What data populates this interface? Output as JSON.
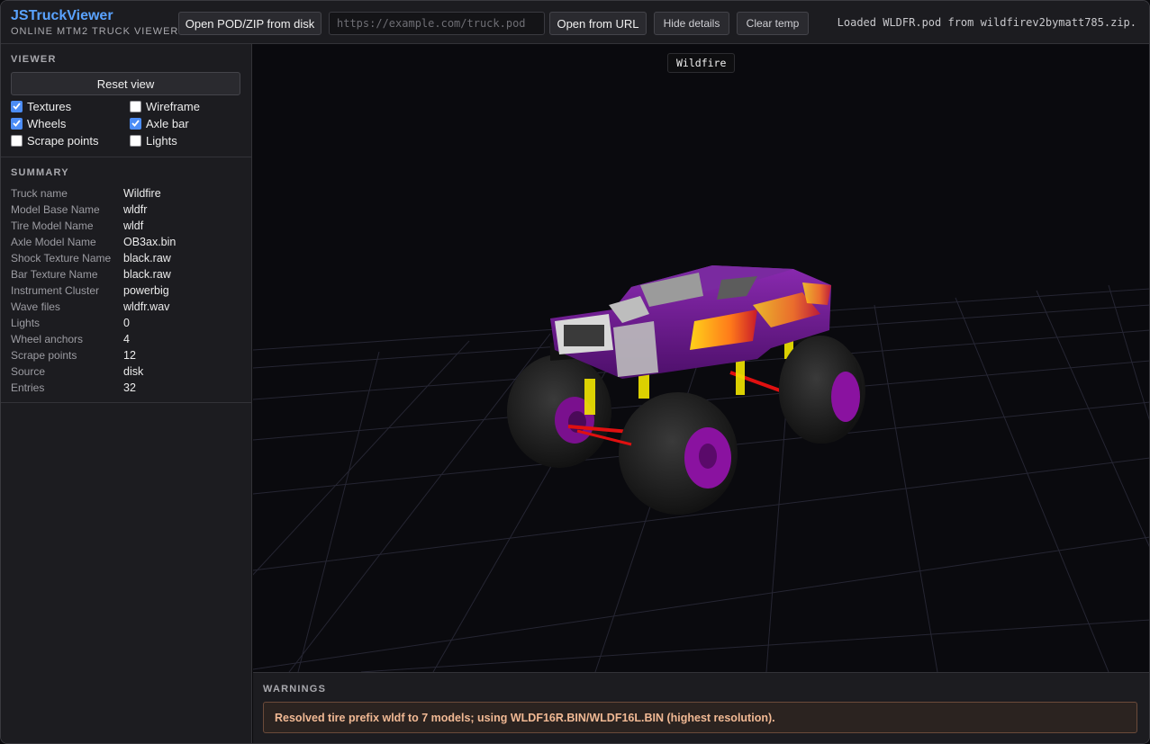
{
  "header": {
    "brand_title": "JSTruckViewer",
    "brand_subtitle": "ONLINE MTM2 TRUCK VIEWER",
    "open_disk_label": "Open POD/ZIP from disk",
    "url_placeholder": "https://example.com/truck.pod",
    "url_value": "",
    "open_url_label": "Open from URL",
    "hide_details_label": "Hide details",
    "clear_temp_label": "Clear temp",
    "status_text": "Loaded WLDFR.pod from wildfirev2bymatt785.zip."
  },
  "viewer": {
    "section_title": "VIEWER",
    "reset_label": "Reset view",
    "options": [
      {
        "label": "Textures",
        "checked": true
      },
      {
        "label": "Wireframe",
        "checked": false
      },
      {
        "label": "Wheels",
        "checked": true
      },
      {
        "label": "Axle bar",
        "checked": true
      },
      {
        "label": "Scrape points",
        "checked": false
      },
      {
        "label": "Lights",
        "checked": false
      }
    ]
  },
  "summary": {
    "section_title": "SUMMARY",
    "rows": [
      {
        "key": "Truck name",
        "value": "Wildfire"
      },
      {
        "key": "Model Base Name",
        "value": "wldfr"
      },
      {
        "key": "Tire Model Name",
        "value": "wldf"
      },
      {
        "key": "Axle Model Name",
        "value": "OB3ax.bin"
      },
      {
        "key": "Shock Texture Name",
        "value": "black.raw"
      },
      {
        "key": "Bar Texture Name",
        "value": "black.raw"
      },
      {
        "key": "Instrument Cluster",
        "value": "powerbig"
      },
      {
        "key": "Wave files",
        "value": "wldfr.wav"
      },
      {
        "key": "Lights",
        "value": "0"
      },
      {
        "key": "Wheel anchors",
        "value": "4"
      },
      {
        "key": "Scrape points",
        "value": "12"
      },
      {
        "key": "Source",
        "value": "disk"
      },
      {
        "key": "Entries",
        "value": "32"
      }
    ]
  },
  "viewport": {
    "truck_label": "Wildfire",
    "colors": {
      "body": "#6a1a8c",
      "wheel_rim": "#8a12a0",
      "shock": "#f2e600",
      "axle": "#e01010",
      "grid": "#2a2a35"
    }
  },
  "warnings": {
    "section_title": "WARNINGS",
    "message": "Resolved tire prefix wldf to 7 models; using WLDF16R.BIN/WLDF16L.BIN (highest resolution)."
  }
}
